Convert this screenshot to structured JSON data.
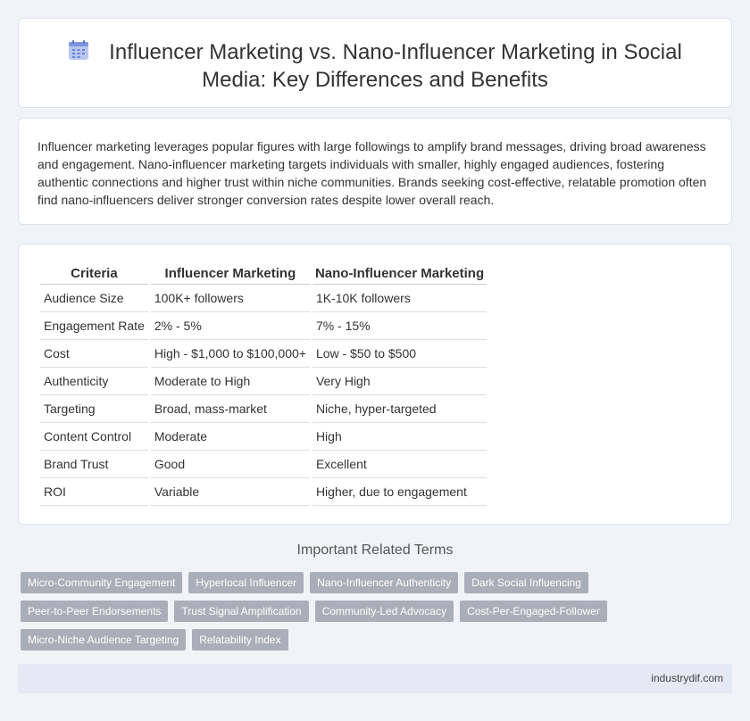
{
  "header": {
    "title": "Influencer Marketing vs. Nano-Influencer Marketing in Social Media: Key Differences and Benefits",
    "icon": "calendar-icon"
  },
  "intro": "Influencer marketing leverages popular figures with large followings to amplify brand messages, driving broad awareness and engagement. Nano-influencer marketing targets individuals with smaller, highly engaged audiences, fostering authentic connections and higher trust within niche communities. Brands seeking cost-effective, relatable promotion often find nano-influencers deliver stronger conversion rates despite lower overall reach.",
  "table": {
    "headers": [
      "Criteria",
      "Influencer Marketing",
      "Nano-Influencer Marketing"
    ],
    "rows": [
      [
        "Audience Size",
        "100K+ followers",
        "1K-10K followers"
      ],
      [
        "Engagement Rate",
        "2% - 5%",
        "7% - 15%"
      ],
      [
        "Cost",
        "High - $1,000 to $100,000+",
        "Low - $50 to $500"
      ],
      [
        "Authenticity",
        "Moderate to High",
        "Very High"
      ],
      [
        "Targeting",
        "Broad, mass-market",
        "Niche, hyper-targeted"
      ],
      [
        "Content Control",
        "Moderate",
        "High"
      ],
      [
        "Brand Trust",
        "Good",
        "Excellent"
      ],
      [
        "ROI",
        "Variable",
        "Higher, due to engagement"
      ]
    ]
  },
  "related": {
    "heading": "Important Related Terms",
    "rows": [
      [
        "Micro-Community Engagement",
        "Hyperlocal Influencer",
        "Nano-Influencer Authenticity",
        "Dark Social Influencing"
      ],
      [
        "Peer-to-Peer Endorsements",
        "Trust Signal Amplification",
        "Community-Led Advocacy",
        "Cost-Per-Engaged-Follower"
      ],
      [
        "Micro-Niche Audience Targeting",
        "Relatability Index"
      ]
    ]
  },
  "footer": {
    "site": "industrydif.com"
  }
}
